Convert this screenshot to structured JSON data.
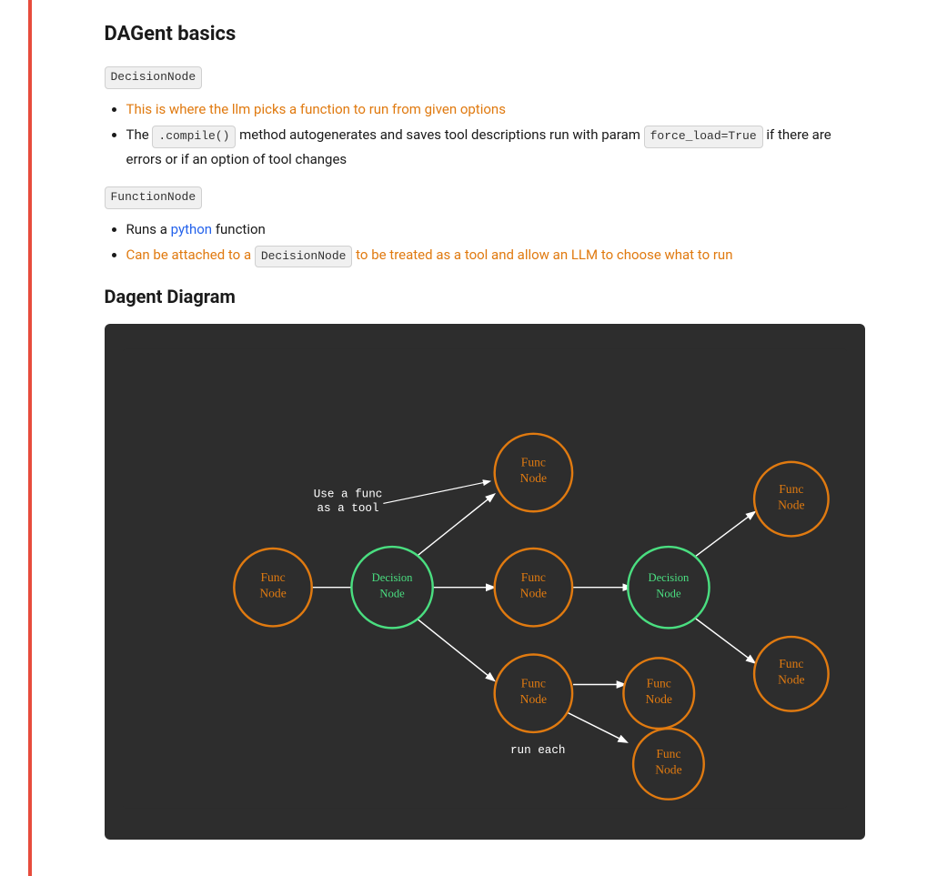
{
  "page": {
    "title": "DAGent basics",
    "section1": {
      "badge": "DecisionNode",
      "bullets": [
        {
          "parts": [
            {
              "text": "This is where the llm picks a function to run from given options",
              "color": "orange"
            }
          ]
        },
        {
          "parts": [
            {
              "text": "The ",
              "color": "dark"
            },
            {
              "text": ".compile()",
              "code": true
            },
            {
              "text": " method autogenerates and saves tool descriptions run with param ",
              "color": "dark"
            },
            {
              "text": "force_load=True",
              "code": true
            },
            {
              "text": " if there are errors or if an option of tool changes",
              "color": "dark"
            }
          ]
        }
      ]
    },
    "section2": {
      "badge": "FunctionNode",
      "bullets": [
        {
          "parts": [
            {
              "text": "Runs a ",
              "color": "dark"
            },
            {
              "text": "python",
              "color": "blue"
            },
            {
              "text": " function",
              "color": "dark"
            }
          ]
        },
        {
          "parts": [
            {
              "text": "Can be attached to a ",
              "color": "orange"
            },
            {
              "text": "DecisionNode",
              "code": true
            },
            {
              "text": " to be treated as a tool and allow an ",
              "color": "orange"
            },
            {
              "text": "LLM",
              "color": "orange"
            },
            {
              "text": " to choose what to run",
              "color": "orange"
            }
          ]
        }
      ]
    },
    "diagram_title": "Dagent Diagram",
    "diagram_alt": "DAGent node diagram showing FuncNode and DecisionNode connections"
  }
}
